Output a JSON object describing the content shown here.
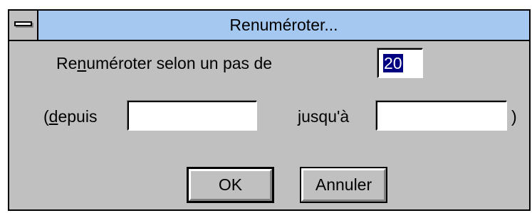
{
  "dialog": {
    "title": "Renuméroter...",
    "system_menu_icon": "window-system-menu-icon"
  },
  "step": {
    "label_before": "Re",
    "label_mnemonic": "n",
    "label_after": "uméroter selon un pas de",
    "value": "20"
  },
  "range": {
    "from_prefix": "(",
    "from_mnemonic": "d",
    "from_after": "epuis",
    "from_value": "",
    "to_label": "jusqu'à",
    "to_value": "",
    "closing": ")"
  },
  "buttons": {
    "ok_label": "OK",
    "cancel_label": "Annuler"
  },
  "colors": {
    "title_bar": "#a4c8f0",
    "dialog_face": "#c0c0c0",
    "selection": "#000080"
  }
}
